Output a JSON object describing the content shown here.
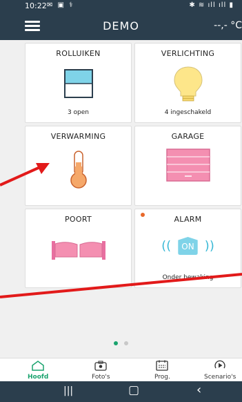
{
  "status_bar": {
    "time": "10:22",
    "left_icons": "✉ ▣ ⚕",
    "right_icons": "✱ ≋ ıll ıll ▮"
  },
  "app_bar": {
    "title": "DEMO",
    "temperature": "--,- °C"
  },
  "tiles": [
    {
      "label": "ROLLUIKEN",
      "status": "3 open",
      "icon": "shutter-icon"
    },
    {
      "label": "VERLICHTING",
      "status": "4 ingeschakeld",
      "icon": "bulb-icon"
    },
    {
      "label": "VERWARMING",
      "status": "",
      "icon": "thermometer-icon"
    },
    {
      "label": "GARAGE",
      "status": "",
      "icon": "garage-door-icon"
    },
    {
      "label": "POORT",
      "status": "",
      "icon": "gate-icon"
    },
    {
      "label": "ALARM",
      "status": "Onder bewaking",
      "icon": "alarm-icon",
      "badge": "ON"
    }
  ],
  "nav": [
    {
      "label": "Hoofd",
      "icon": "home-icon",
      "active": true
    },
    {
      "label": "Foto's",
      "icon": "camera-icon",
      "active": false
    },
    {
      "label": "Prog.",
      "icon": "calendar-icon",
      "active": false
    },
    {
      "label": "Scenario's",
      "icon": "play-icon",
      "active": false
    }
  ],
  "colors": {
    "app_bar": "#2b3e4d",
    "accent": "#1aa36e",
    "icon_blue": "#7fd3e8",
    "icon_pink": "#f48fb1",
    "icon_orange": "#f5a86a",
    "annotation_red": "#e21a1a"
  }
}
